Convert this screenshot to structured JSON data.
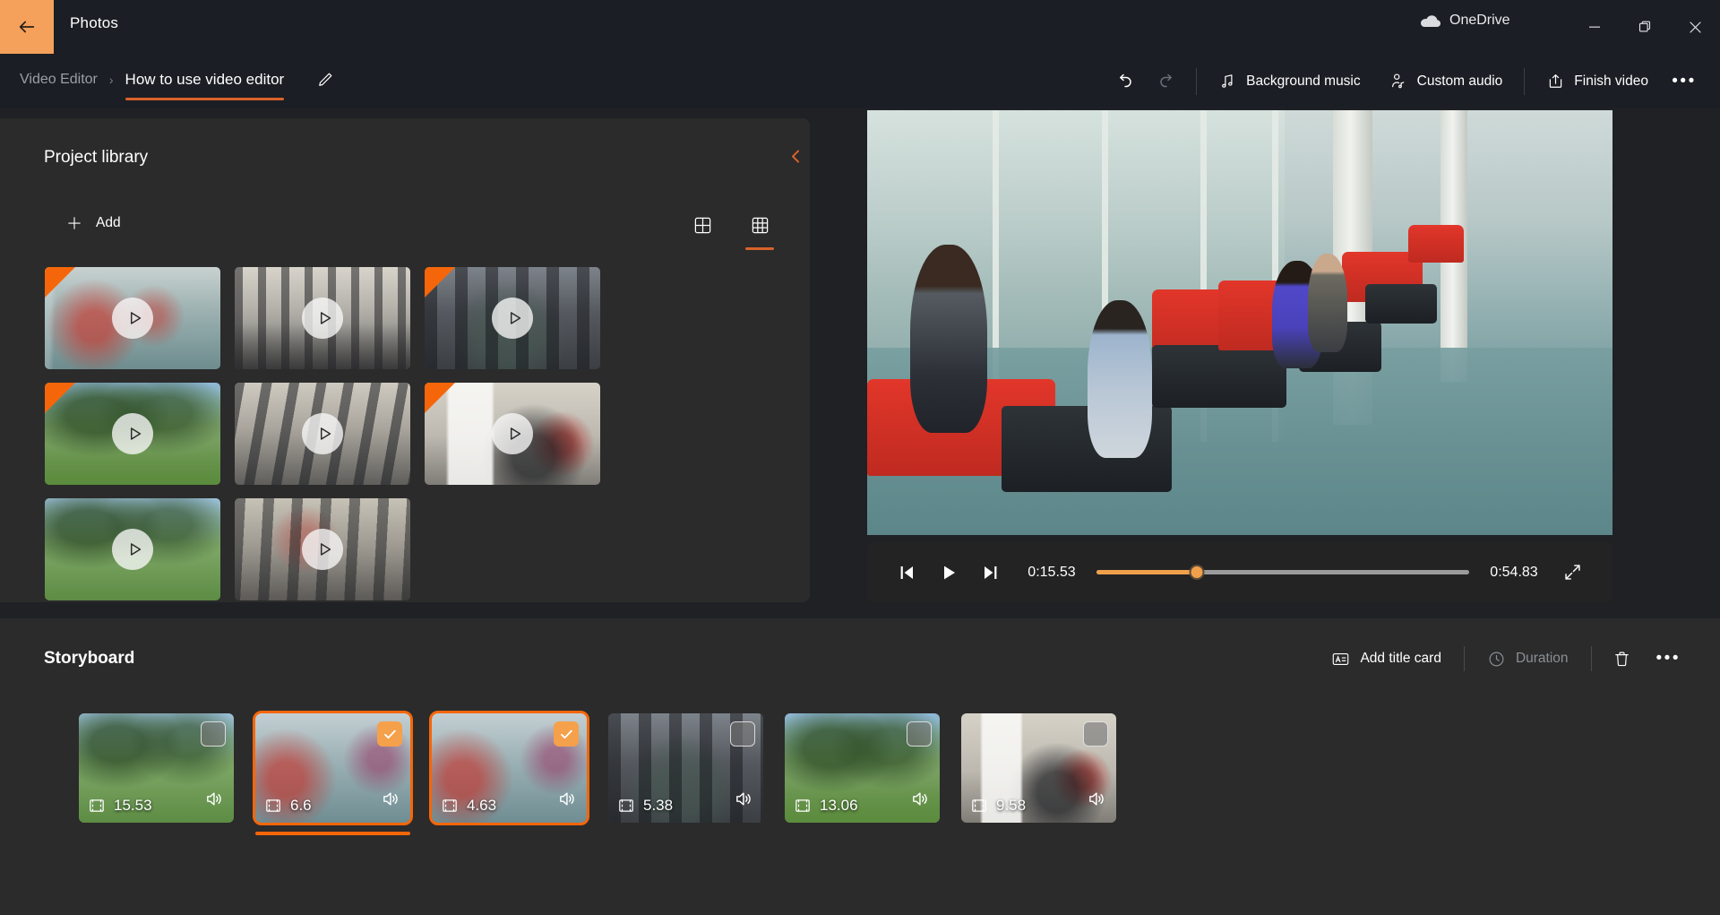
{
  "titlebar": {
    "back_icon": "back-arrow-icon",
    "app_name": "Photos",
    "onedrive_label": "OneDrive",
    "onedrive_icon": "onedrive-cloud-icon",
    "minimize_icon": "minimize-icon",
    "restore_icon": "restore-icon",
    "close_icon": "close-icon"
  },
  "commandbar": {
    "breadcrumb_root": "Video Editor",
    "breadcrumb_separator": "›",
    "project_title": "How to use video editor",
    "edit_icon": "pencil-icon",
    "undo_icon": "undo-icon",
    "redo_icon": "redo-icon",
    "background_music": "Background music",
    "background_music_icon": "music-note-icon",
    "custom_audio": "Custom audio",
    "custom_audio_icon": "person-audio-icon",
    "finish_video": "Finish video",
    "finish_video_icon": "share-export-icon",
    "more_label": "•••"
  },
  "library": {
    "title": "Project library",
    "collapse_icon": "chevron-left-icon",
    "add_label": "Add",
    "add_icon": "plus-icon",
    "view_large_icon": "grid-2x2-icon",
    "view_small_icon": "grid-3x3-icon",
    "view_selected": "grid-3x3-icon",
    "items": [
      {
        "scene": "sc-hall",
        "used": true,
        "play_icon": "play-icon"
      },
      {
        "scene": "sc-lab",
        "used": false,
        "play_icon": "play-icon"
      },
      {
        "scene": "sc-patio",
        "used": true,
        "play_icon": "play-icon"
      },
      {
        "scene": "sc-lawn",
        "used": true,
        "play_icon": "play-icon"
      },
      {
        "scene": "sc-lab2",
        "used": false,
        "play_icon": "play-icon"
      },
      {
        "scene": "sc-class",
        "used": true,
        "play_icon": "play-icon"
      },
      {
        "scene": "sc-quad",
        "used": false,
        "play_icon": "play-icon"
      },
      {
        "scene": "sc-bigroom",
        "used": false,
        "play_icon": "play-icon"
      }
    ]
  },
  "player": {
    "prev_frame_icon": "previous-frame-icon",
    "play_icon": "play-icon",
    "next_frame_icon": "next-frame-icon",
    "current_time": "0:15.53",
    "total_time": "0:54.83",
    "progress_percent": 27,
    "fullscreen_icon": "fullscreen-icon"
  },
  "storyboard": {
    "title": "Storyboard",
    "add_title_card": "Add title card",
    "add_title_card_icon": "title-card-icon",
    "duration_label": "Duration",
    "duration_icon": "clock-icon",
    "duration_disabled": true,
    "delete_icon": "trash-icon",
    "more_label": "•••",
    "clips": [
      {
        "duration": "15.53",
        "selected": false,
        "scene": "sc-quad",
        "film_icon": "film-strip-icon",
        "audio_icon": "speaker-icon"
      },
      {
        "duration": "6.6",
        "selected": true,
        "scene": "sc-corridor",
        "film_icon": "film-strip-icon",
        "audio_icon": "speaker-icon"
      },
      {
        "duration": "4.63",
        "selected": true,
        "scene": "sc-corridor",
        "film_icon": "film-strip-icon",
        "audio_icon": "speaker-icon"
      },
      {
        "duration": "5.38",
        "selected": false,
        "scene": "sc-patio",
        "film_icon": "film-strip-icon",
        "audio_icon": "speaker-icon"
      },
      {
        "duration": "13.06",
        "selected": false,
        "scene": "sc-lawn",
        "film_icon": "film-strip-icon",
        "audio_icon": "speaker-icon"
      },
      {
        "duration": "9.58",
        "selected": false,
        "scene": "sc-class",
        "film_icon": "film-strip-icon",
        "audio_icon": "speaker-icon"
      }
    ]
  },
  "colors": {
    "accent_orange": "#f5660a",
    "accent_soft": "#f0a04b",
    "panel": "#2b2b2b",
    "chrome": "#1b1e24"
  }
}
